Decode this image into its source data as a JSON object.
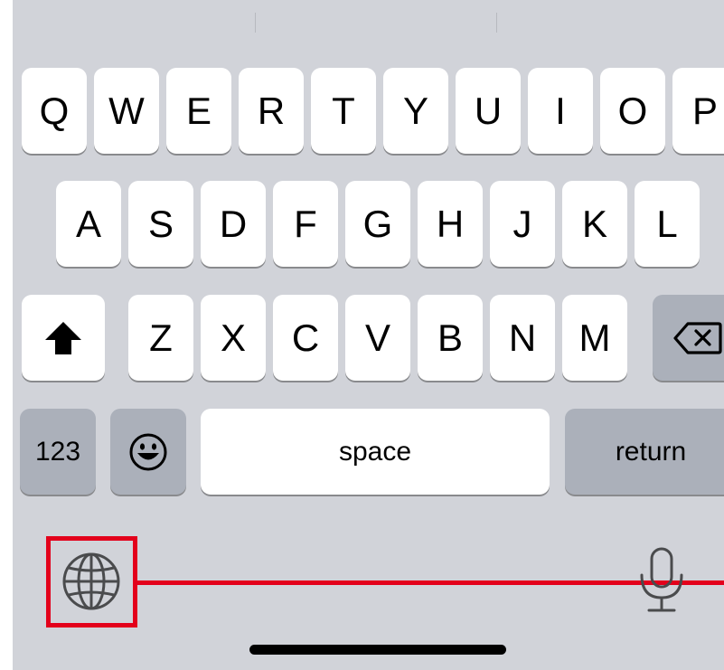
{
  "keyboard": {
    "row1": [
      "Q",
      "W",
      "E",
      "R",
      "T",
      "Y",
      "U",
      "I",
      "O",
      "P"
    ],
    "row2": [
      "A",
      "S",
      "D",
      "F",
      "G",
      "H",
      "J",
      "K",
      "L"
    ],
    "row3": [
      "Z",
      "X",
      "C",
      "V",
      "B",
      "N",
      "M"
    ],
    "shift_icon": "shift-icon",
    "delete_icon": "delete-icon",
    "numbers_label": "123",
    "emoji_icon": "emoji-icon",
    "space_label": "space",
    "return_label": "return",
    "globe_icon": "globe-icon",
    "mic_icon": "microphone-icon"
  },
  "annotation": {
    "highlight_color": "#e3001b",
    "target": "globe-icon"
  },
  "colors": {
    "keyboard_bg": "#d1d3d9",
    "letter_key": "#ffffff",
    "function_key": "#abb0ba"
  }
}
